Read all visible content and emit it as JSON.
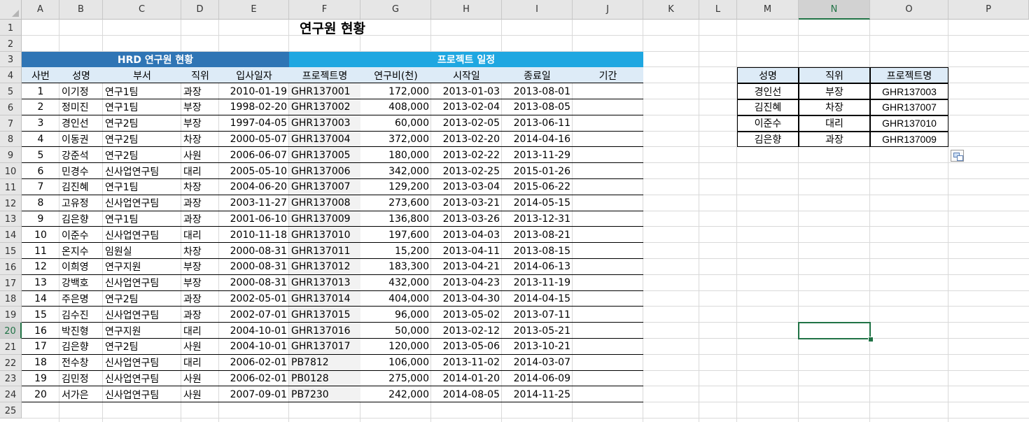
{
  "columns": [
    "A",
    "B",
    "C",
    "D",
    "E",
    "F",
    "G",
    "H",
    "I",
    "J",
    "K",
    "L",
    "M",
    "N",
    "O",
    "P"
  ],
  "rows": [
    "1",
    "2",
    "3",
    "4",
    "5",
    "6",
    "7",
    "8",
    "9",
    "10",
    "11",
    "12",
    "13",
    "14",
    "15",
    "16",
    "17",
    "18",
    "19",
    "20",
    "21",
    "22",
    "23",
    "24",
    "25"
  ],
  "title": "연구원 현황",
  "group_headers": {
    "left": "HRD 연구원 현황",
    "right": "프로젝트 일정"
  },
  "table_headers": [
    "사번",
    "성명",
    "부서",
    "직위",
    "입사일자",
    "프로젝트명",
    "연구비(천)",
    "시작일",
    "종료일",
    "기간"
  ],
  "table_rows": [
    [
      "1",
      "이기정",
      "연구1팀",
      "과장",
      "2010-01-19",
      "GHR137001",
      "172,000",
      "2013-01-03",
      "2013-08-01"
    ],
    [
      "2",
      "정미진",
      "연구1팀",
      "부장",
      "1998-02-20",
      "GHR137002",
      "408,000",
      "2013-02-04",
      "2013-08-05"
    ],
    [
      "3",
      "경인선",
      "연구2팀",
      "부장",
      "1997-04-05",
      "GHR137003",
      "60,000",
      "2013-02-05",
      "2013-06-11"
    ],
    [
      "4",
      "이동권",
      "연구2팀",
      "차장",
      "2000-05-07",
      "GHR137004",
      "372,000",
      "2013-02-20",
      "2014-04-16"
    ],
    [
      "5",
      "강준석",
      "연구2팀",
      "사원",
      "2006-06-07",
      "GHR137005",
      "180,000",
      "2013-02-22",
      "2013-11-29"
    ],
    [
      "6",
      "민경수",
      "신사업연구팀",
      "대리",
      "2005-05-10",
      "GHR137006",
      "342,000",
      "2013-02-25",
      "2015-01-26"
    ],
    [
      "7",
      "김진혜",
      "연구1팀",
      "차장",
      "2004-06-20",
      "GHR137007",
      "129,200",
      "2013-03-04",
      "2015-06-22"
    ],
    [
      "8",
      "고유정",
      "신사업연구팀",
      "과장",
      "2003-11-27",
      "GHR137008",
      "273,600",
      "2013-03-21",
      "2014-05-15"
    ],
    [
      "9",
      "김은향",
      "연구1팀",
      "과장",
      "2001-06-10",
      "GHR137009",
      "136,800",
      "2013-03-26",
      "2013-12-31"
    ],
    [
      "10",
      "이준수",
      "신사업연구팀",
      "대리",
      "2010-11-18",
      "GHR137010",
      "197,600",
      "2013-04-03",
      "2013-08-21"
    ],
    [
      "11",
      "온지수",
      "임원실",
      "차장",
      "2000-08-31",
      "GHR137011",
      "15,200",
      "2013-04-11",
      "2013-08-15"
    ],
    [
      "12",
      "이희영",
      "연구지원",
      "부장",
      "2000-08-31",
      "GHR137012",
      "183,300",
      "2013-04-21",
      "2014-06-13"
    ],
    [
      "13",
      "강백호",
      "신사업연구팀",
      "부장",
      "2000-08-31",
      "GHR137013",
      "432,000",
      "2013-04-23",
      "2013-11-19"
    ],
    [
      "14",
      "주은명",
      "연구2팀",
      "과장",
      "2002-05-01",
      "GHR137014",
      "404,000",
      "2013-04-30",
      "2014-04-15"
    ],
    [
      "15",
      "김수진",
      "신사업연구팀",
      "과장",
      "2002-07-01",
      "GHR137015",
      "96,000",
      "2013-05-02",
      "2013-07-11"
    ],
    [
      "16",
      "박진형",
      "연구지원",
      "대리",
      "2004-10-01",
      "GHR137016",
      "50,000",
      "2013-02-12",
      "2013-05-21"
    ],
    [
      "17",
      "김은향",
      "연구2팀",
      "사원",
      "2004-10-01",
      "GHR137017",
      "120,000",
      "2013-05-06",
      "2013-10-21"
    ],
    [
      "18",
      "전수창",
      "신사업연구팀",
      "대리",
      "2006-02-01",
      "PB7812",
      "106,000",
      "2013-11-02",
      "2014-03-07"
    ],
    [
      "19",
      "김민정",
      "신사업연구팀",
      "사원",
      "2006-02-01",
      "PB0128",
      "275,000",
      "2014-01-20",
      "2014-06-09"
    ],
    [
      "20",
      "서가은",
      "신사업연구팀",
      "사원",
      "2007-09-01",
      "PB7230",
      "242,000",
      "2014-08-05",
      "2014-11-25"
    ]
  ],
  "lookup_headers": [
    "성명",
    "직위",
    "프로젝트명"
  ],
  "lookup_rows": [
    [
      "경인선",
      "부장",
      "GHR137003"
    ],
    [
      "김진혜",
      "차장",
      "GHR137007"
    ],
    [
      "이준수",
      "대리",
      "GHR137010"
    ],
    [
      "김은향",
      "과장",
      "GHR137009"
    ]
  ],
  "selected_cell": "N20",
  "colors": {
    "band_dark": "#2f75b5",
    "band_light": "#1fa7e1",
    "header_fill": "#ddebf7",
    "selection": "#217346"
  },
  "icons": {
    "paste_options": "paste-options-icon",
    "select_all": "select-all-icon"
  }
}
